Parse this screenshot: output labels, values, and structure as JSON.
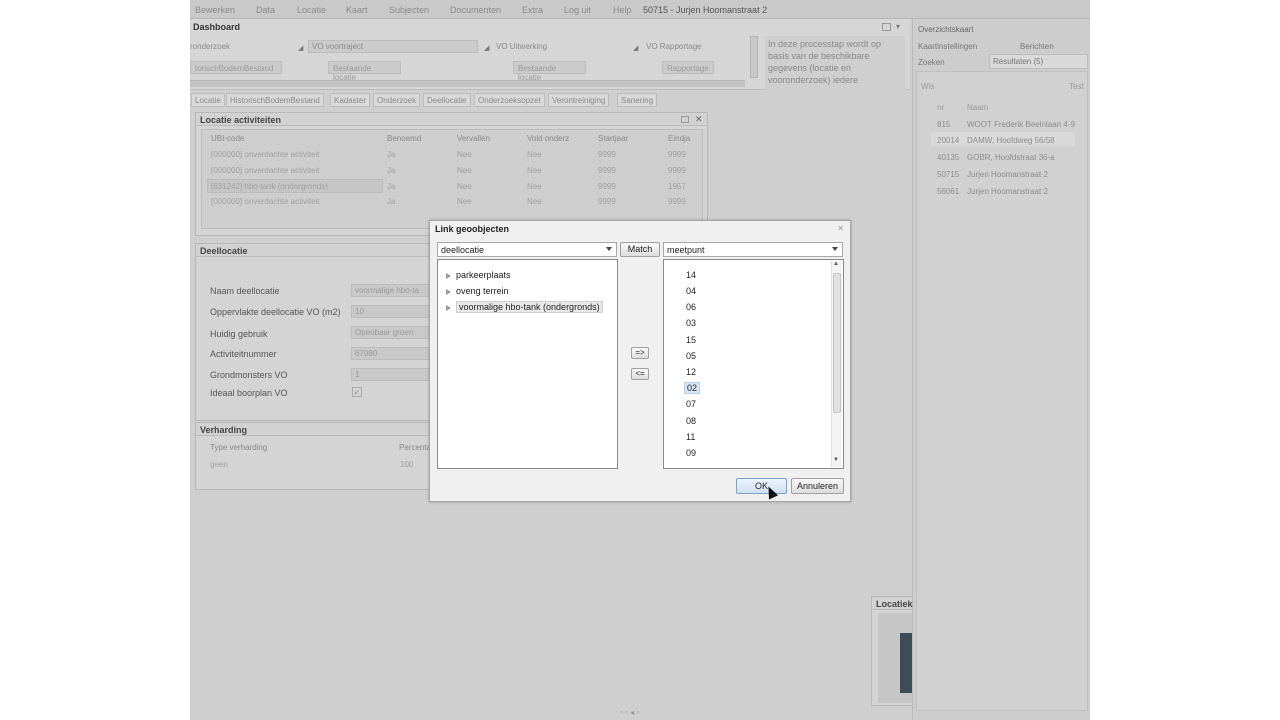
{
  "menu": {
    "items": [
      "Bewerken",
      "Data",
      "Locatie",
      "Kaart",
      "Subjecten",
      "Documenten",
      "Extra",
      "Log uit",
      "Help"
    ],
    "location": "50715 - Jurjen Hoomanstraat 2"
  },
  "dashboard": {
    "title": "Dashboard",
    "steps": [
      "ronderzoek",
      "VO voortraject",
      "VO Uitwerking",
      "VO Rapportage"
    ],
    "buttons": [
      "torischBodemBestand",
      "Bestaande locatie",
      "Bestaande locatie",
      "Rapportage"
    ],
    "info": "In deze processtap wordt op basis van de beschikbare gegevens (locatie en vooronderzoek) iedere"
  },
  "right_panel": {
    "overview": "Overzichtskaart",
    "tabs_row1": [
      "Kaartinstellingen",
      "Berichten"
    ],
    "tabs_row2": [
      "Zoeken",
      "Resultaten (5)"
    ],
    "toolbar": [
      "Wis",
      "Test"
    ],
    "columns": [
      "nr",
      "Naam"
    ],
    "rows": [
      [
        "815",
        "WOOT Frederik Beelnlaan 4-9"
      ],
      [
        "20014",
        "DAMW, Hoofdweg 56/58"
      ],
      [
        "40135",
        "GOBR, Hoofdstraat 36-a"
      ],
      [
        "50715",
        "Jurjen Hoomanstraat 2"
      ],
      [
        "56061",
        "Jurjen Hoomanstraat 2"
      ]
    ]
  },
  "tabs": [
    "Locatie",
    "HistorischBodemBestand",
    "Kadaster",
    "Onderzoek",
    "Deellocatie",
    "Onderzoeksopzet",
    "Verontreiniging",
    "Sanering"
  ],
  "locatie_activiteiten": {
    "title": "Locatie activiteiten",
    "columns": [
      "UBI-code",
      "Benoemd",
      "Vervallen",
      "Vold onderz",
      "Startjaar",
      "Eindja"
    ],
    "rows": [
      [
        "[000000] onverdachte activiteit",
        "Ja",
        "Nee",
        "Nee",
        "9999",
        "9999"
      ],
      [
        "[000000] onverdachte activiteit",
        "Ja",
        "Nee",
        "Nee",
        "9999",
        "9999"
      ],
      [
        "[631242] hbo-tank (ondergronds)",
        "Ja",
        "Nee",
        "Nee",
        "9999",
        "1957"
      ],
      [
        "[000000] onverdachte activiteit",
        "Ja",
        "Nee",
        "Nee",
        "9999",
        "9999"
      ]
    ]
  },
  "deellocatie": {
    "title": "Deellocatie",
    "fields": [
      {
        "label": "Naam deellocatie",
        "value": "voormalige hbo-ta"
      },
      {
        "label": "Oppervlakte deellocatie VO (m2)",
        "value": "10"
      },
      {
        "label": "Huidig gebruik",
        "value": "Openbaar groen"
      },
      {
        "label": "Activiteitnummer",
        "value": "67080"
      },
      {
        "label": "Grondmonsters VO",
        "value": "1"
      },
      {
        "label": "Ideaal boorplan VO",
        "value": "✓"
      }
    ]
  },
  "verharding": {
    "title": "Verharding",
    "columns": [
      "Type verharding",
      "Percenta"
    ],
    "row": [
      "geen",
      "100"
    ]
  },
  "locatie_kaart": "Locatiek",
  "dialog": {
    "title": "Link geoobjecten",
    "close": "✕",
    "left_combo": "deellocatie",
    "match_label": "Match",
    "right_combo": "meetpunt",
    "tree": [
      "parkeerplaats",
      "oveng terrein",
      "voormalige hbo-tank (ondergronds)"
    ],
    "meetpunten": [
      "14",
      "04",
      "06",
      "03",
      "15",
      "05",
      "12",
      "02",
      "07",
      "08",
      "11",
      "09"
    ],
    "selected_meetpunt": "02",
    "link_label": "=>",
    "unlink_label": "<=",
    "ok_label": "OK",
    "cancel_label": "Annuleren"
  }
}
